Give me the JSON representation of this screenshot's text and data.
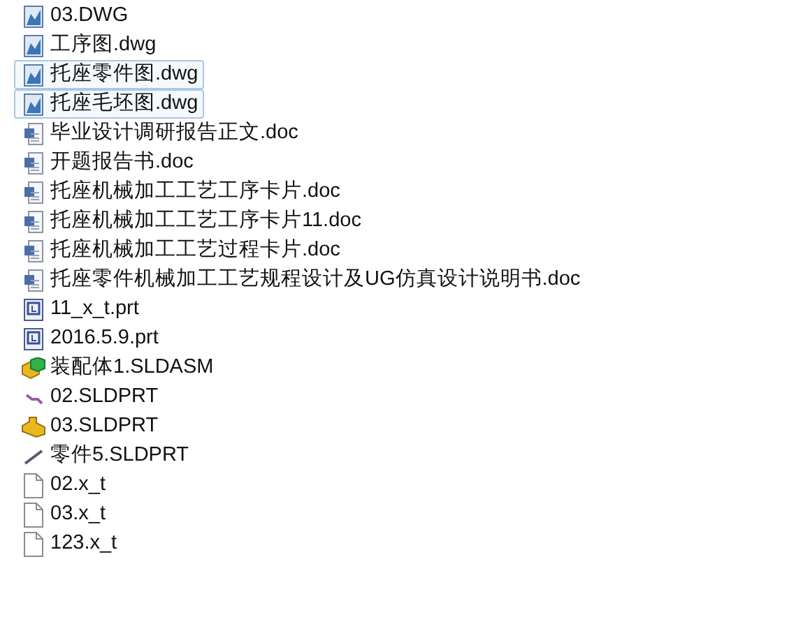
{
  "files": [
    {
      "name": "03.DWG",
      "kind": "dwg",
      "selected": false
    },
    {
      "name": "工序图.dwg",
      "kind": "dwg",
      "selected": false
    },
    {
      "name": "托座零件图.dwg",
      "kind": "dwg",
      "selected": true
    },
    {
      "name": "托座毛坯图.dwg",
      "kind": "dwg",
      "selected": true
    },
    {
      "name": "毕业设计调研报告正文.doc",
      "kind": "doc",
      "selected": false
    },
    {
      "name": "开题报告书.doc",
      "kind": "doc",
      "selected": false
    },
    {
      "name": "托座机械加工工艺工序卡片.doc",
      "kind": "doc",
      "selected": false
    },
    {
      "name": "托座机械加工工艺工序卡片11.doc",
      "kind": "doc",
      "selected": false
    },
    {
      "name": "托座机械加工工艺过程卡片.doc",
      "kind": "doc",
      "selected": false
    },
    {
      "name": "托座零件机械加工工艺规程设计及UG仿真设计说明书.doc",
      "kind": "doc",
      "selected": false
    },
    {
      "name": "11_x_t.prt",
      "kind": "prt",
      "selected": false
    },
    {
      "name": "2016.5.9.prt",
      "kind": "prt",
      "selected": false
    },
    {
      "name": "装配体1.SLDASM",
      "kind": "asm",
      "selected": false
    },
    {
      "name": "02.SLDPRT",
      "kind": "chain",
      "selected": false
    },
    {
      "name": "03.SLDPRT",
      "kind": "part",
      "selected": false
    },
    {
      "name": "零件5.SLDPRT",
      "kind": "rod",
      "selected": false
    },
    {
      "name": "02.x_t",
      "kind": "blank",
      "selected": false
    },
    {
      "name": "03.x_t",
      "kind": "blank",
      "selected": false
    },
    {
      "name": "123.x_t",
      "kind": "blank",
      "selected": false
    }
  ]
}
